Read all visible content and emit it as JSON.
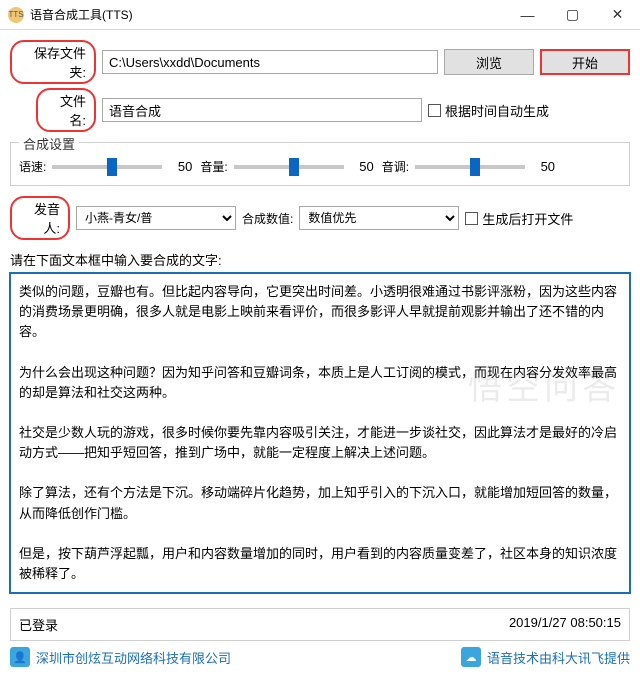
{
  "window": {
    "title": "语音合成工具(TTS)",
    "icon_text": "TTS"
  },
  "row1": {
    "label": "保存文件夹:",
    "path": "C:\\Users\\xxdd\\Documents",
    "browse": "浏览",
    "start": "开始"
  },
  "row2": {
    "label": "文件名:",
    "value": "语音合成",
    "checkbox": "根据时间自动生成"
  },
  "settings": {
    "legend": "合成设置",
    "speed_label": "语速:",
    "speed_value": "50",
    "volume_label": "音量:",
    "volume_value": "50",
    "pitch_label": "音调:",
    "pitch_value": "50"
  },
  "row3": {
    "speaker_label": "发音人:",
    "speaker_value": "小燕-青女/普",
    "quality_label": "合成数值:",
    "quality_value": "数值优先",
    "checkbox": "生成后打开文件"
  },
  "prompt": "请在下面文本框中输入要合成的文字:",
  "text": "类似的问题，豆瓣也有。但比起内容导向，它更突出时间差。小透明很难通过书影评涨粉，因为这些内容的消费场景更明确，很多人就是电影上映前来看评价，而很多影评人早就提前观影并输出了还不错的内容。\n\n为什么会出现这种问题？因为知乎问答和豆瓣词条，本质上是人工订阅的模式，而现在内容分发效率最高的却是算法和社交这两种。\n\n社交是少数人玩的游戏，很多时候你要先靠内容吸引关注，才能进一步谈社交，因此算法才是最好的冷启动方式——把知乎短回答，推到广场中，就能一定程度上解决上述问题。\n\n除了算法，还有个方法是下沉。移动端碎片化趋势，加上知乎引入的下沉入口，就能增加短回答的数量，从而降低创作门槛。\n\n但是，按下葫芦浮起瓢，用户和内容数量增加的同时，用户看到的内容质量变差了，社区本身的知识浓度被稀释了。",
  "status": {
    "login": "已登录",
    "time": "2019/1/27 08:50:15"
  },
  "footer": {
    "company": "深圳市创炫互动网络科技有限公司",
    "provider": "语音技术由科大讯飞提供"
  },
  "watermark": "悟空问答"
}
